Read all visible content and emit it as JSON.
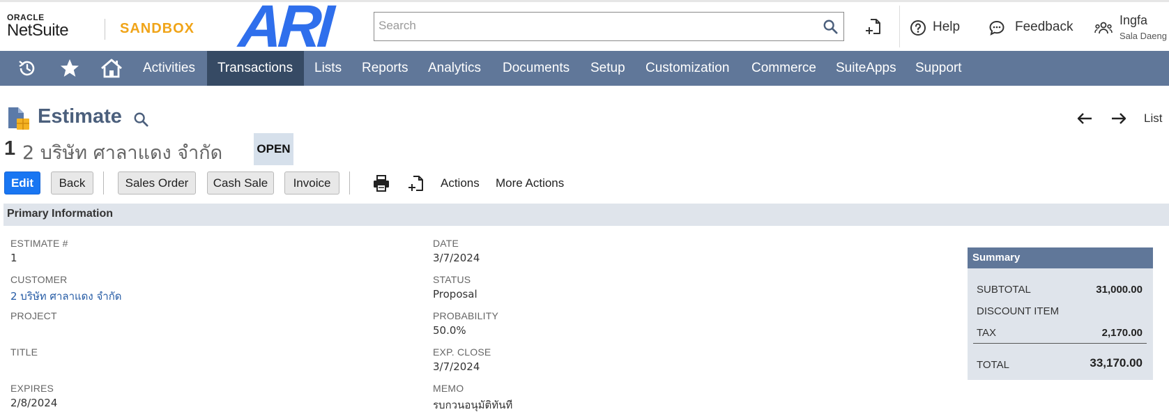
{
  "header": {
    "logo_oracle": "ORACLE",
    "logo_netsuite": "NetSuite",
    "sandbox": "SANDBOX",
    "brand": "ARI",
    "search_placeholder": "Search",
    "help": "Help",
    "feedback": "Feedback",
    "user_name": "Ingfa",
    "user_sub": "Sala Daeng"
  },
  "nav": {
    "items": [
      "Activities",
      "Transactions",
      "Lists",
      "Reports",
      "Analytics",
      "Documents",
      "Setup",
      "Customization",
      "Commerce",
      "SuiteApps",
      "Support"
    ],
    "active": "Transactions"
  },
  "page": {
    "title": "Estimate",
    "list_link": "List",
    "record_number": "1",
    "record_name": "2 บริษัท ศาลาแดง จำกัด",
    "status_badge": "OPEN"
  },
  "toolbar": {
    "edit": "Edit",
    "back": "Back",
    "sales_order": "Sales Order",
    "cash_sale": "Cash Sale",
    "invoice": "Invoice",
    "actions": "Actions",
    "more_actions": "More Actions"
  },
  "primary": {
    "section_title": "Primary Information",
    "fields": {
      "estimate_num": {
        "label": "ESTIMATE #",
        "value": "1"
      },
      "customer": {
        "label": "CUSTOMER",
        "value": "2 บริษัท ศาลาแดง จำกัด"
      },
      "project": {
        "label": "PROJECT",
        "value": ""
      },
      "title": {
        "label": "TITLE",
        "value": ""
      },
      "expires": {
        "label": "EXPIRES",
        "value": "2/8/2024"
      },
      "date": {
        "label": "DATE",
        "value": "3/7/2024"
      },
      "status": {
        "label": "STATUS",
        "value": "Proposal"
      },
      "probability": {
        "label": "PROBABILITY",
        "value": "50.0%"
      },
      "exp_close": {
        "label": "EXP. CLOSE",
        "value": "3/7/2024"
      },
      "memo": {
        "label": "MEMO",
        "value": "รบกวนอนุมัติทันที"
      }
    }
  },
  "summary": {
    "title": "Summary",
    "subtotal_label": "SUBTOTAL",
    "subtotal_value": "31,000.00",
    "discount_label": "DISCOUNT ITEM",
    "tax_label": "TAX",
    "tax_value": "2,170.00",
    "total_label": "TOTAL",
    "total_value": "33,170.00"
  },
  "colors": {
    "nav_bg": "#607799",
    "nav_active": "#364a64",
    "primary_button": "#1976f2",
    "brand_blue": "#2f6fec",
    "sandbox_orange": "#f0a418"
  }
}
